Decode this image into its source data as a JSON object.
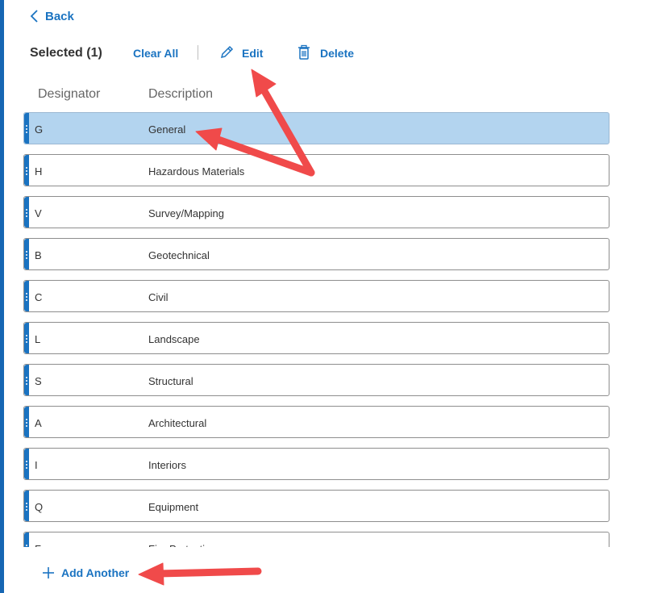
{
  "nav": {
    "back_label": "Back"
  },
  "toolbar": {
    "selected_label": "Selected (1)",
    "clear_all_label": "Clear All",
    "edit_label": "Edit",
    "delete_label": "Delete"
  },
  "table": {
    "columns": [
      "Designator",
      "Description"
    ],
    "rows": [
      {
        "designator": "G",
        "description": "General",
        "selected": true
      },
      {
        "designator": "H",
        "description": "Hazardous Materials",
        "selected": false
      },
      {
        "designator": "V",
        "description": "Survey/Mapping",
        "selected": false
      },
      {
        "designator": "B",
        "description": "Geotechnical",
        "selected": false
      },
      {
        "designator": "C",
        "description": "Civil",
        "selected": false
      },
      {
        "designator": "L",
        "description": "Landscape",
        "selected": false
      },
      {
        "designator": "S",
        "description": "Structural",
        "selected": false
      },
      {
        "designator": "A",
        "description": "Architectural",
        "selected": false
      },
      {
        "designator": "I",
        "description": "Interiors",
        "selected": false
      },
      {
        "designator": "Q",
        "description": "Equipment",
        "selected": false
      },
      {
        "designator": "F",
        "description": "Fire Protection",
        "selected": false
      }
    ]
  },
  "footer": {
    "add_another_label": "Add Another"
  },
  "colors": {
    "accent": "#1a73c1",
    "rail": "#1666b3",
    "selected_row": "#b3d4ef",
    "annotation_arrow": "#f04a4a"
  },
  "icons": {
    "back": "chevron-left-icon",
    "edit": "pencil-icon",
    "delete": "trash-icon",
    "add": "plus-icon",
    "row_handle": "drag-handle-icon"
  }
}
